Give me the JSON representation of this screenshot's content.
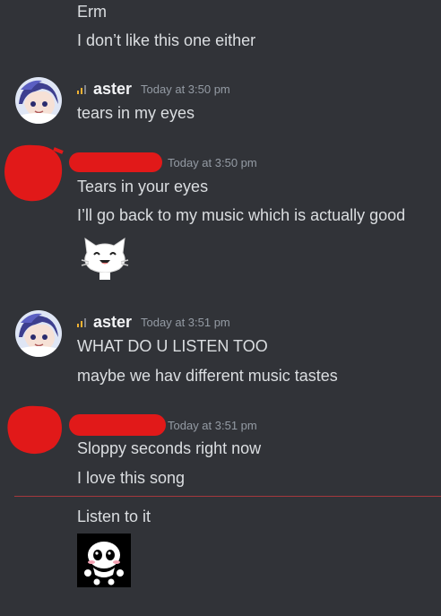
{
  "colors": {
    "background": "#313338",
    "text": "#dbdee1",
    "username": "#f2f3f5",
    "timestamp": "#949ba4",
    "redaction": "#e11919",
    "new_messages_divider": "#a5383d",
    "signal_active": "#f0b232"
  },
  "messages": [
    {
      "text": "Erm"
    },
    {
      "text": "I don’t like this one either"
    },
    {
      "author": "aster",
      "timestamp": "Today at 3:50 pm",
      "lines": [
        "tears in my eyes"
      ]
    },
    {
      "author_redacted": true,
      "timestamp": "Today at 3:50 pm",
      "lines": [
        "Tears in your eyes",
        "I’ll go back to my music which is actually good"
      ],
      "sticker": "cat-face-sticker"
    },
    {
      "author": "aster",
      "timestamp": "Today at 3:51 pm",
      "lines": [
        "WHAT DO U LISTEN TOO",
        "maybe we hav different music tastes"
      ]
    },
    {
      "author_redacted": true,
      "timestamp": "Today at 3:51 pm",
      "lines": [
        "Sloppy seconds right now",
        "I love this song"
      ]
    },
    {
      "lines": [
        "Listen to it"
      ],
      "sticker": "skull-creature-emoji"
    }
  ]
}
